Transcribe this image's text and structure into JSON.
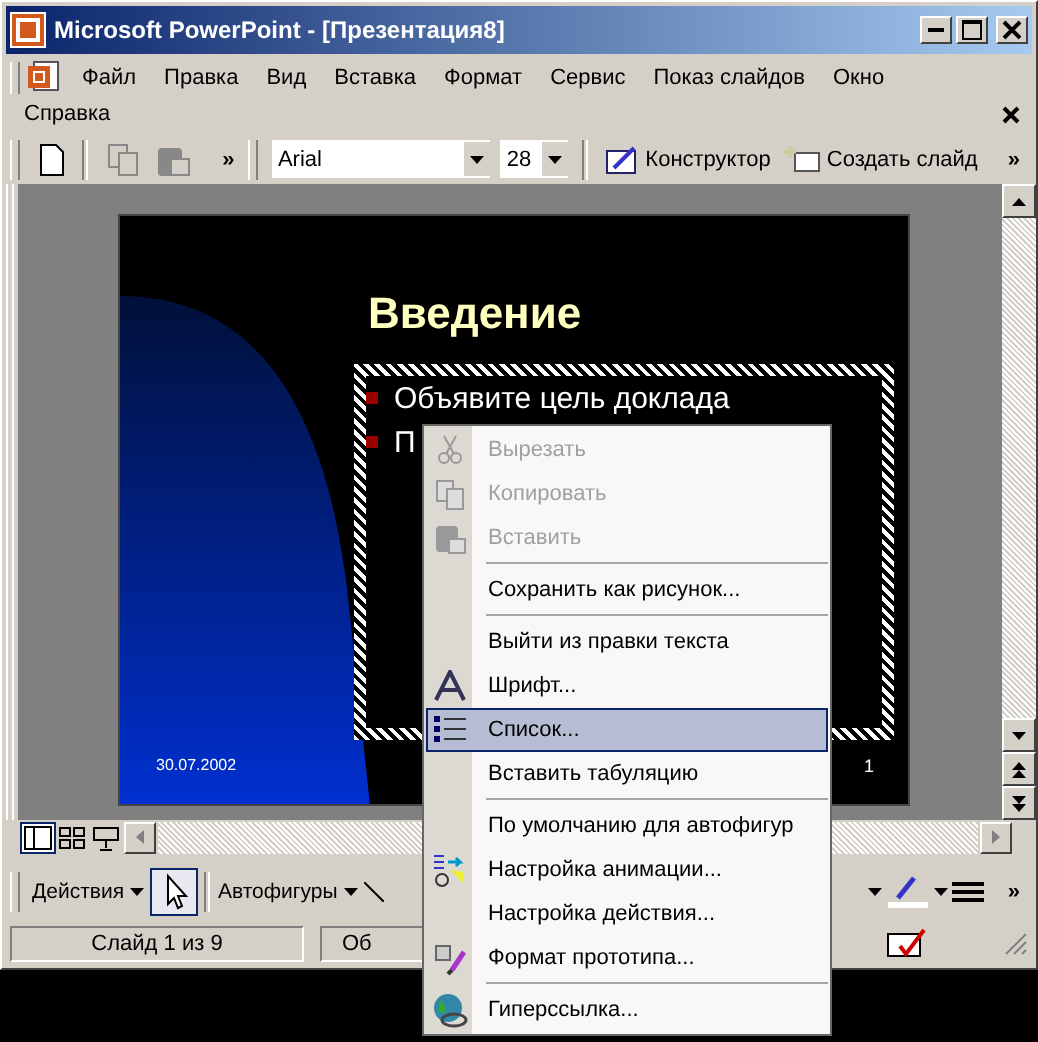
{
  "window": {
    "title": "Microsoft PowerPoint - [Презентация8]"
  },
  "menu_bar": {
    "items": [
      {
        "label": "Файл"
      },
      {
        "label": "Правка"
      },
      {
        "label": "Вид"
      },
      {
        "label": "Вставка"
      },
      {
        "label": "Формат"
      },
      {
        "label": "Сервис"
      },
      {
        "label": "Показ слайдов"
      },
      {
        "label": "Окно"
      },
      {
        "label": "Справка"
      }
    ]
  },
  "toolbar": {
    "font": "Arial",
    "size": "28",
    "buttons": [
      "Конструктор",
      "Создать слайд"
    ],
    "chevrons": [
      "»",
      "»"
    ]
  },
  "slide": {
    "title": "Введение",
    "bullets": [
      "Объявите цель доклада",
      "П"
    ],
    "date": "30.07.2002",
    "number": "1"
  },
  "context_menu": [
    {
      "label": "Вырезать",
      "disabled": true,
      "selected": false,
      "separator_before": false
    },
    {
      "label": "Копировать",
      "disabled": true,
      "selected": false,
      "separator_before": false
    },
    {
      "label": "Вставить",
      "disabled": true,
      "selected": false,
      "separator_before": false
    },
    {
      "label": "Сохранить как рисунок...",
      "disabled": false,
      "selected": false,
      "separator_before": true
    },
    {
      "label": "Выйти из правки текста",
      "disabled": false,
      "selected": false,
      "separator_before": true
    },
    {
      "label": "Шрифт...",
      "disabled": false,
      "selected": false,
      "separator_before": false
    },
    {
      "label": "Список...",
      "disabled": false,
      "selected": true,
      "separator_before": false
    },
    {
      "label": "Вставить табуляцию",
      "disabled": false,
      "selected": false,
      "separator_before": false
    },
    {
      "label": "По умолчанию для автофигур",
      "disabled": false,
      "selected": false,
      "separator_before": true
    },
    {
      "label": "Настройка анимации...",
      "disabled": false,
      "selected": false,
      "separator_before": false
    },
    {
      "label": "Настройка действия...",
      "disabled": false,
      "selected": false,
      "separator_before": false
    },
    {
      "label": "Формат прототипа...",
      "disabled": false,
      "selected": false,
      "separator_before": false
    },
    {
      "label": "Гиперссылка...",
      "disabled": false,
      "selected": false,
      "separator_before": true
    }
  ],
  "drawing_toolbar": {
    "actions": "Действия",
    "autoshapes": "Автофигуры",
    "chevron": "»"
  },
  "status_bar": [
    "Слайд 1 из 9",
    "Об"
  ]
}
